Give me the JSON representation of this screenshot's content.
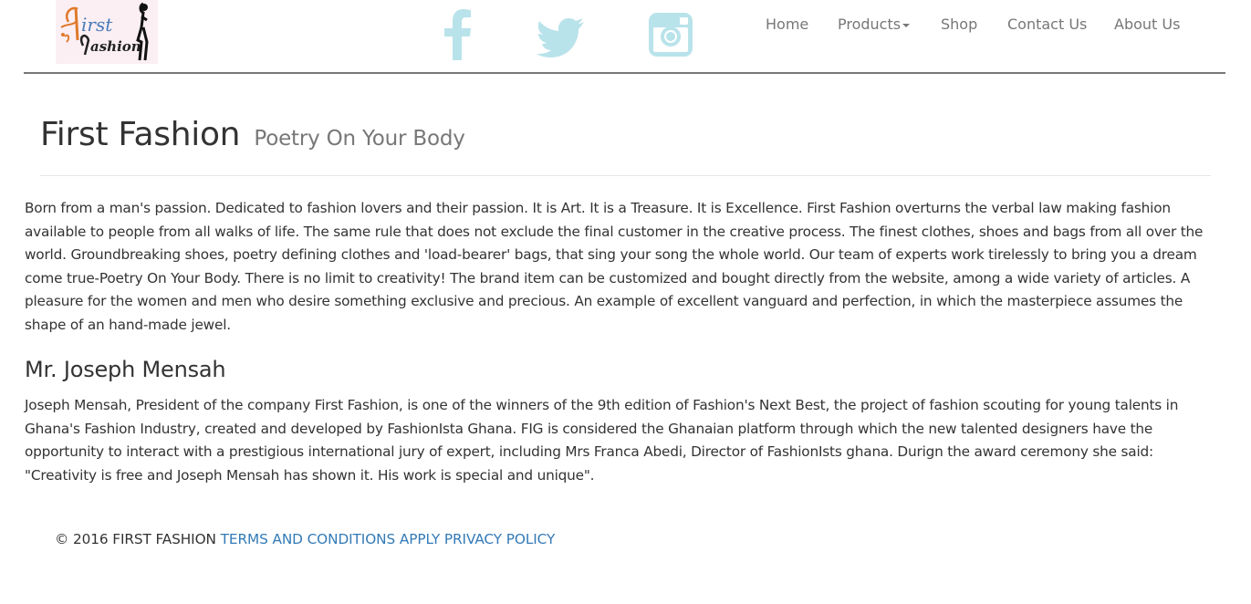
{
  "brand": {
    "logo_text_top": "irst",
    "logo_text_bottom": "ashion"
  },
  "social": {
    "facebook": "facebook-icon",
    "twitter": "twitter-icon",
    "instagram": "instagram-icon",
    "color": "#b9e3ea"
  },
  "nav": {
    "home": "Home",
    "products": "Products",
    "shop": "Shop",
    "contact": "Contact Us",
    "about": "About Us"
  },
  "header": {
    "title": "First Fashion",
    "subtitle": "Poetry On Your Body"
  },
  "intro": "Born from a man's passion. Dedicated to fashion lovers and their passion. It is Art. It is a Treasure. It is Excellence. First Fashion overturns the verbal law making fashion available to people from all walks of life. The same rule that does not exclude the final customer in the creative process. The finest clothes, shoes and bags from all over the world. Groundbreaking shoes, poetry defining clothes and 'load-bearer' bags, that sing your song the whole world. Our team of experts work tirelessly to bring you a dream come true-Poetry On Your Body. There is no limit to creativity! The brand item can be customized and bought directly from the website, among a wide variety of articles. A pleasure for the women and men who desire something exclusive and precious. An example of excellent vanguard and perfection, in which the masterpiece assumes the shape of an hand-made jewel.",
  "founder": {
    "heading": "Mr. Joseph Mensah",
    "bio": "Joseph Mensah, President of the company First Fashion, is one of the winners of the 9th edition of Fashion's Next Best, the project of fashion scouting for young talents in Ghana's Fashion Industry, created and developed by FashionIsta Ghana. FIG is considered the Ghanaian platform through which the new talented designers have the opportunity to interact with a prestigious international jury of expert, including Mrs Franca Abedi, Director of FashionIsts ghana. Durign the award ceremony she said: \"Creativity is free and Joseph Mensah has shown it. His work is special and unique\"."
  },
  "footer": {
    "copyright": "© 2016 FIRST FASHION",
    "terms": "TERMS AND CONDITIONS APPLY",
    "privacy": "PRIVACY POLICY"
  }
}
